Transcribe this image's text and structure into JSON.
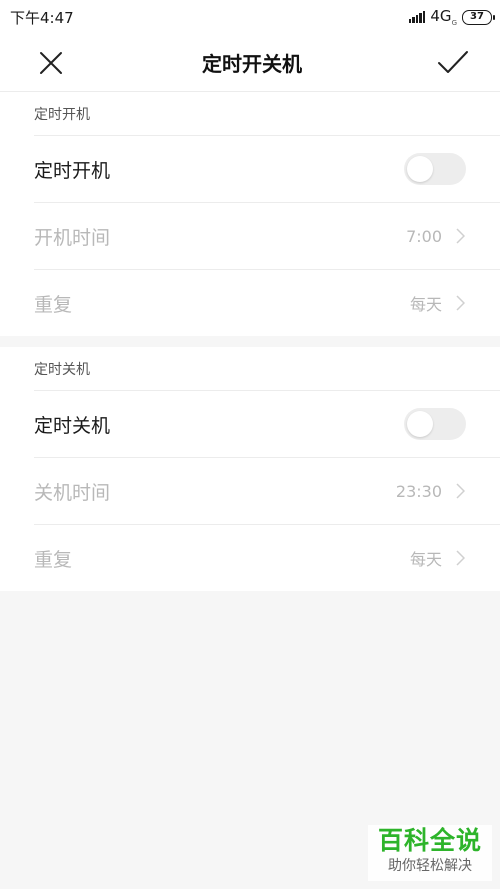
{
  "status_bar": {
    "time": "下午4:47",
    "network": "4G",
    "network_sub": "G",
    "battery": "37"
  },
  "header": {
    "title": "定时开关机",
    "close_icon": "close-icon",
    "confirm_icon": "check-icon"
  },
  "power_on": {
    "section_title": "定时开机",
    "toggle_label": "定时开机",
    "toggle_on": false,
    "time_label": "开机时间",
    "time_value": "7:00",
    "repeat_label": "重复",
    "repeat_value": "每天"
  },
  "power_off": {
    "section_title": "定时关机",
    "toggle_label": "定时关机",
    "toggle_on": false,
    "time_label": "关机时间",
    "time_value": "23:30",
    "repeat_label": "重复",
    "repeat_value": "每天"
  },
  "watermark": {
    "title": "百科全说",
    "subtitle": "助你轻松解决"
  },
  "colors": {
    "background": "#f6f6f6",
    "card": "#ffffff",
    "disabled_text": "#b8b8b8",
    "toggle_off": "#ededed",
    "watermark_green": "#2db42a"
  }
}
